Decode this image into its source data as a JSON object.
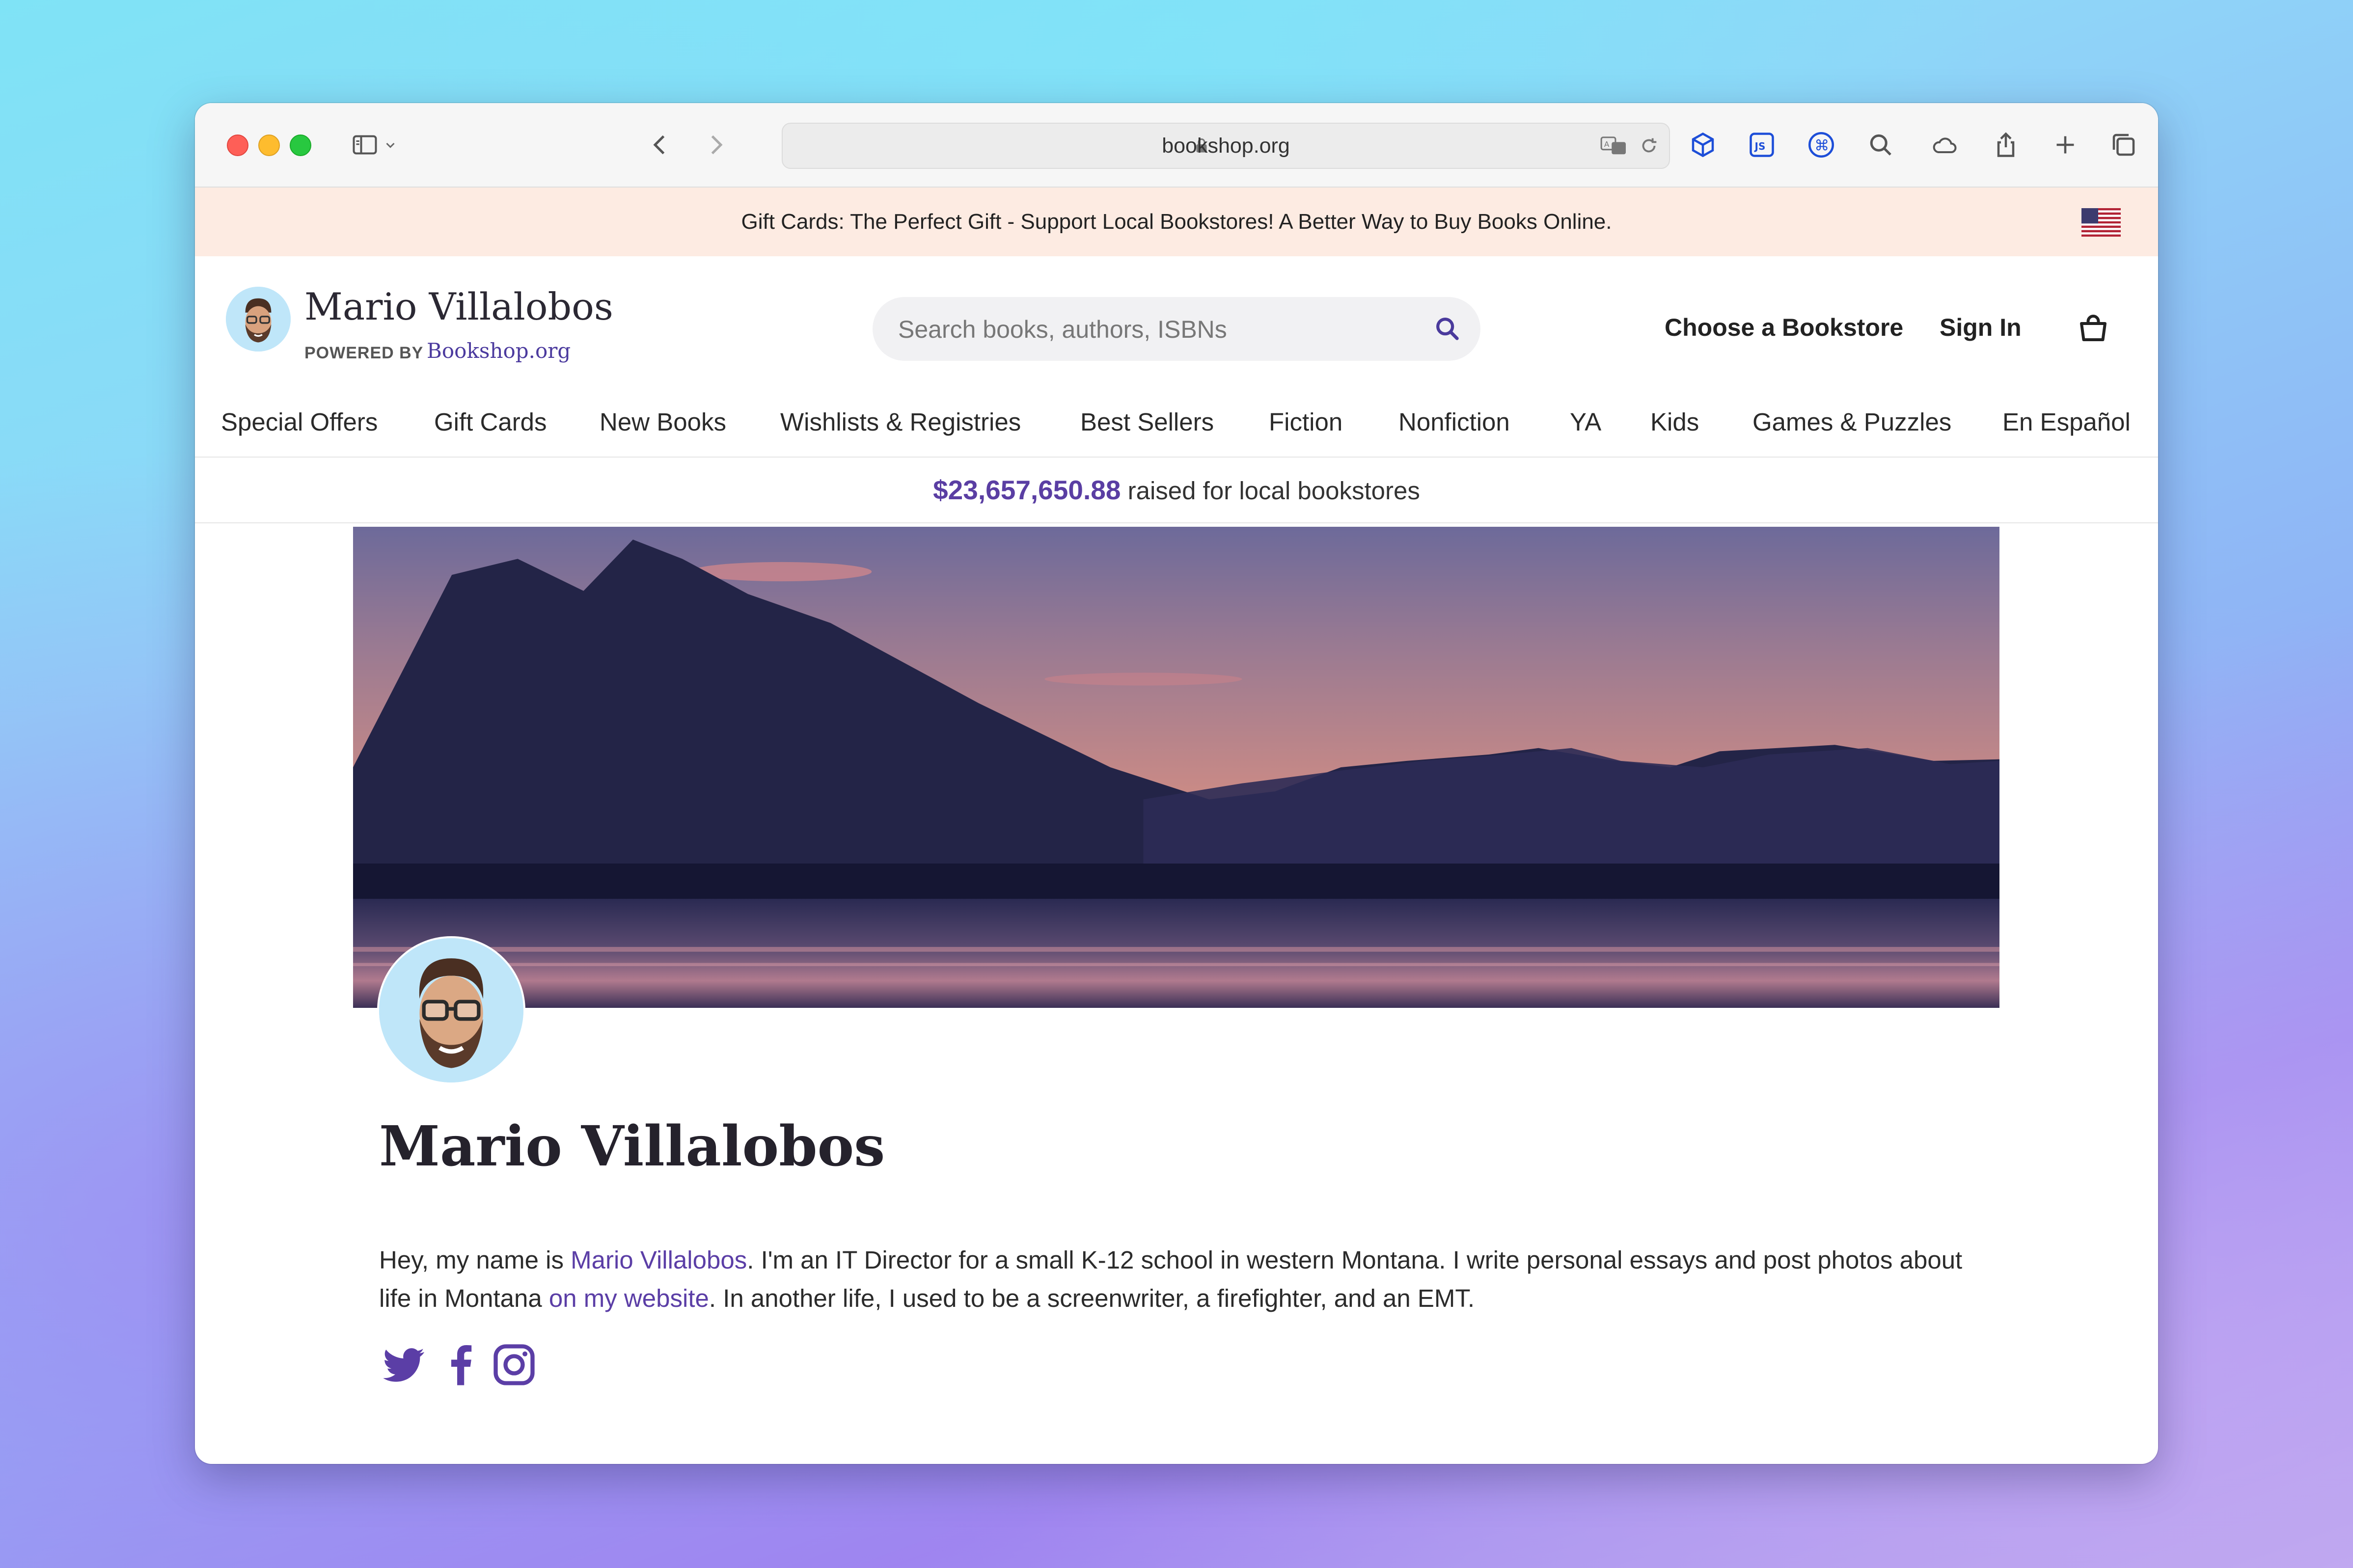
{
  "browser": {
    "url": "bookshop.org"
  },
  "promo": {
    "text": "Gift Cards: The Perfect Gift - Support Local Bookstores! A Better Way to Buy Books Online."
  },
  "header": {
    "site_name": "Mario Villalobos",
    "powered_by": "POWERED BY",
    "brand": "Bookshop.org",
    "search_placeholder": "Search books, authors, ISBNs",
    "choose_store": "Choose a Bookstore",
    "sign_in": "Sign In"
  },
  "nav": {
    "items": [
      {
        "label": "Special Offers"
      },
      {
        "label": "Gift Cards"
      },
      {
        "label": "New Books"
      },
      {
        "label": "Wishlists & Registries"
      },
      {
        "label": "Best Sellers"
      },
      {
        "label": "Fiction"
      },
      {
        "label": "Nonfiction"
      },
      {
        "label": "YA"
      },
      {
        "label": "Kids"
      },
      {
        "label": "Games & Puzzles"
      },
      {
        "label": "En Español"
      }
    ]
  },
  "raised": {
    "amount": "$23,657,650.88",
    "text": " raised for local bookstores"
  },
  "profile": {
    "name": "Mario Villalobos",
    "bio": {
      "part1": "Hey, my name is ",
      "link1": "Mario Villalobos",
      "part2": ". I'm an IT Director for a small K-12 school in western Montana. I write personal essays and post photos about life in Montana ",
      "link2": "on my website",
      "part3": ". In another life, I used to be a screenwriter, a firefighter, and an EMT."
    },
    "social_icons": [
      "twitter-icon",
      "facebook-icon",
      "instagram-icon"
    ]
  },
  "colors": {
    "accent": "#5b3ea6",
    "promo_bg": "#fdebe2"
  }
}
